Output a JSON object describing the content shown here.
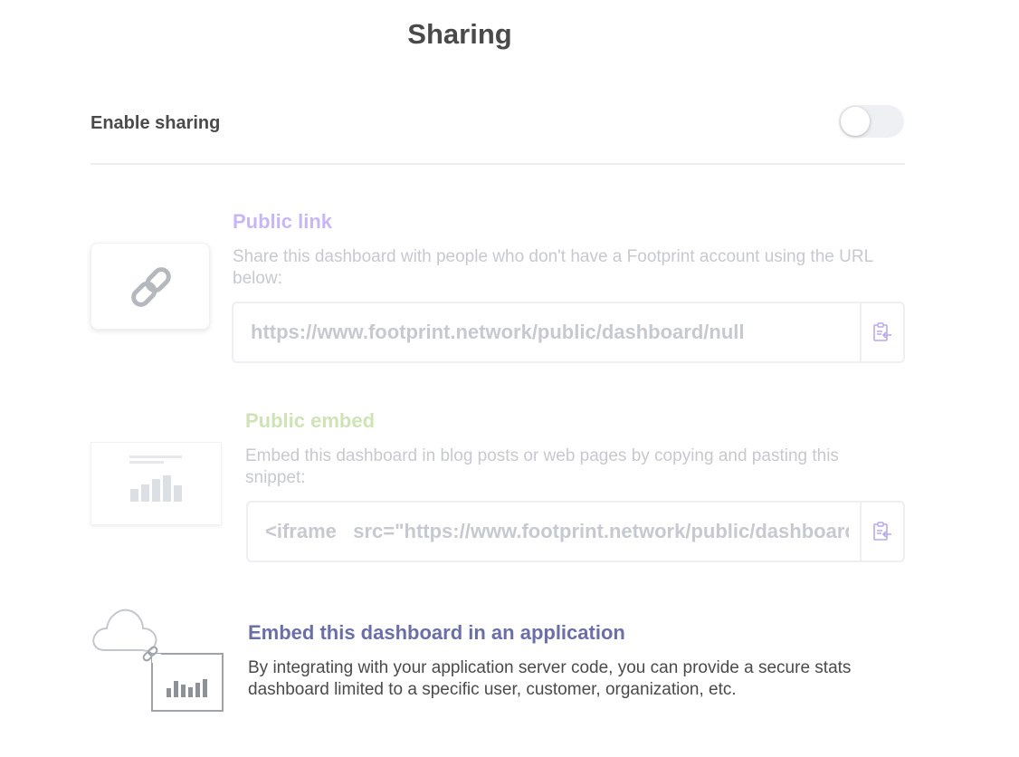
{
  "header": {
    "title": "Sharing"
  },
  "enable_sharing": {
    "label": "Enable sharing",
    "enabled": false
  },
  "public_link": {
    "title": "Public link",
    "description": "Share this dashboard with people who don't have a Footprint account using the URL below:",
    "url": "https://www.footprint.network/public/dashboard/null",
    "copy_icon": "clipboard-icon",
    "card_icon": "link-icon"
  },
  "public_embed": {
    "title": "Public embed",
    "description": "Embed this dashboard in blog posts or web pages by copying and pasting this snippet:",
    "snippet": "<iframe   src=\"https://www.footprint.network/public/dashboard/null\"",
    "copy_icon": "clipboard-icon",
    "card_icon": "embed-preview-icon"
  },
  "app_embed": {
    "title": "Embed this dashboard in an application",
    "description": "By integrating with your application server code, you can provide a secure stats dashboard limited to a specific user, customer, organization, etc.",
    "card_icon": "cloud-chart-icon"
  },
  "colors": {
    "public_link_title": "#c7b8f5",
    "public_embed_title": "#cfe3b6",
    "app_embed_title": "#6b6fa8",
    "muted_text": "#c6c9cf"
  }
}
